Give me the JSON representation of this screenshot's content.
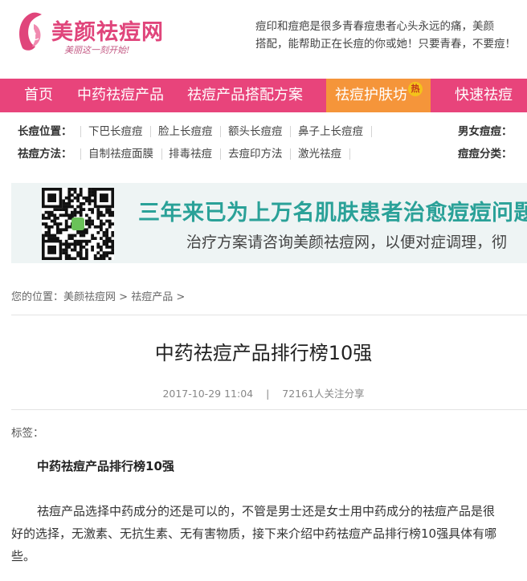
{
  "header": {
    "site_name": "美颜祛痘网",
    "slogan": "美丽这一刻开始!",
    "intro": "痘印和痘疤是很多青春痘患者心头永远的痛，美颜\n搭配，能帮助正在长痘的你或她！只要青春，不要痘！"
  },
  "nav": {
    "items": [
      "首页",
      "中药祛痘产品",
      "祛痘产品搭配方案",
      "祛痘护肤坊",
      "快速祛痘"
    ],
    "active_index": 3,
    "hot_badge": "热",
    "colors": {
      "bar": "#e8447b",
      "active": "#f5953a"
    }
  },
  "categories": {
    "location": {
      "title": "长痘位置：",
      "links": [
        "下巴长痘痘",
        "脸上长痘痘",
        "额头长痘痘",
        "鼻子上长痘痘"
      ],
      "right_label": "男女痘痘："
    },
    "method": {
      "title": "祛痘方法：",
      "links": [
        "自制祛痘面膜",
        "排毒祛痘",
        "去痘印方法",
        "激光祛痘"
      ],
      "right_label": "痘痘分类："
    }
  },
  "banner": {
    "title": "三年来已为上万名肌肤患者治愈痘痘问题",
    "subtitle": "治疗方案请咨询美颜祛痘网，以便对症调理，彻",
    "qr_icon": "qr-code-icon"
  },
  "breadcrumb": {
    "prefix": "您的位置：",
    "items": [
      "美颜祛痘网",
      "祛痘产品"
    ],
    "separator": ">"
  },
  "article": {
    "title": "中药祛痘产品排行榜10强",
    "date": "2017-10-29 11:04",
    "meta_sep": "|",
    "share": "72161人关注分享",
    "tags_label": "标签：",
    "subhead": "中药祛痘产品排行榜10强",
    "body": "祛痘产品选择中药成分的还是可以的，不管是男士还是女士用中药成分的祛痘产品是很好的选择，无激素、无抗生素、无有害物质，接下来介绍中药祛痘产品排行榜10强具体有哪些。"
  }
}
